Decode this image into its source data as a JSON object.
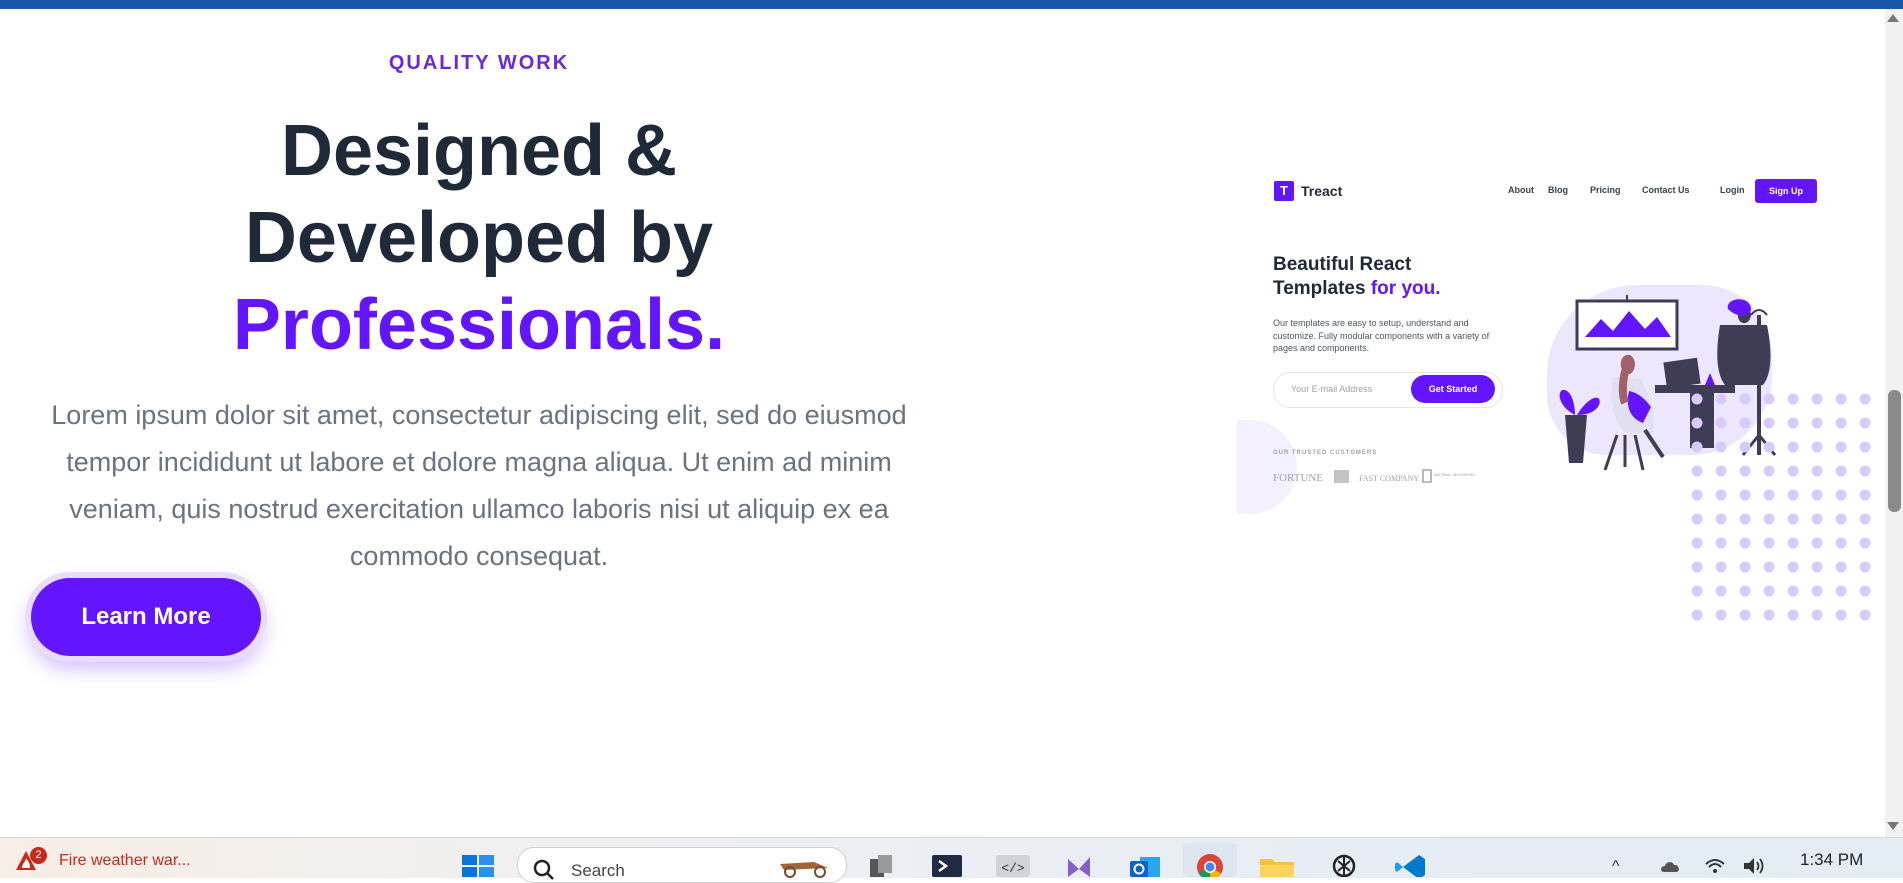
{
  "hero": {
    "subheading": "QUALITY WORK",
    "heading_line1": "Designed &",
    "heading_line2": "Developed by",
    "heading_accent": "Professionals.",
    "description": "Lorem ipsum dolor sit amet, consectetur adipiscing elit, sed do eiusmod tempor incididunt ut labore et dolore magna aliqua. Ut enim ad minim veniam, quis nostrud exercitation ullamco laboris nisi ut aliquip ex ea commodo consequat.",
    "button_label": "Learn More"
  },
  "preview": {
    "logo_letter": "T",
    "logo_text": "Treact",
    "nav": [
      "About",
      "Blog",
      "Pricing",
      "Contact Us",
      "Login"
    ],
    "signup": "Sign Up",
    "title_line1": "Beautiful React",
    "title_line2": "Templates",
    "title_accent": "for you.",
    "text": "Our templates are easy to setup, understand and customize. Fully modular components with a variety of pages and components.",
    "input_placeholder": "Your E-mail Address",
    "cta": "Get Started",
    "trusted_label": "OUR TRUSTED CUSTOMERS",
    "customer_logos": [
      "FORTUNE",
      "FAST COMPANY",
      "NATIONAL GEOGRAPHIC"
    ]
  },
  "taskbar": {
    "weather_badge": "2",
    "weather_text": "Fire weather war...",
    "search_placeholder": "Search",
    "time": "1:34 PM",
    "apps": [
      "task-view",
      "terminal",
      "dev-tools",
      "visual-studio",
      "outlook",
      "chrome",
      "file-explorer",
      "chatgpt",
      "vscode"
    ]
  },
  "colors": {
    "accent": "#6415ff",
    "heading": "#1f2937",
    "body_text": "#6b7280",
    "top_bar": "#1a56a8"
  }
}
